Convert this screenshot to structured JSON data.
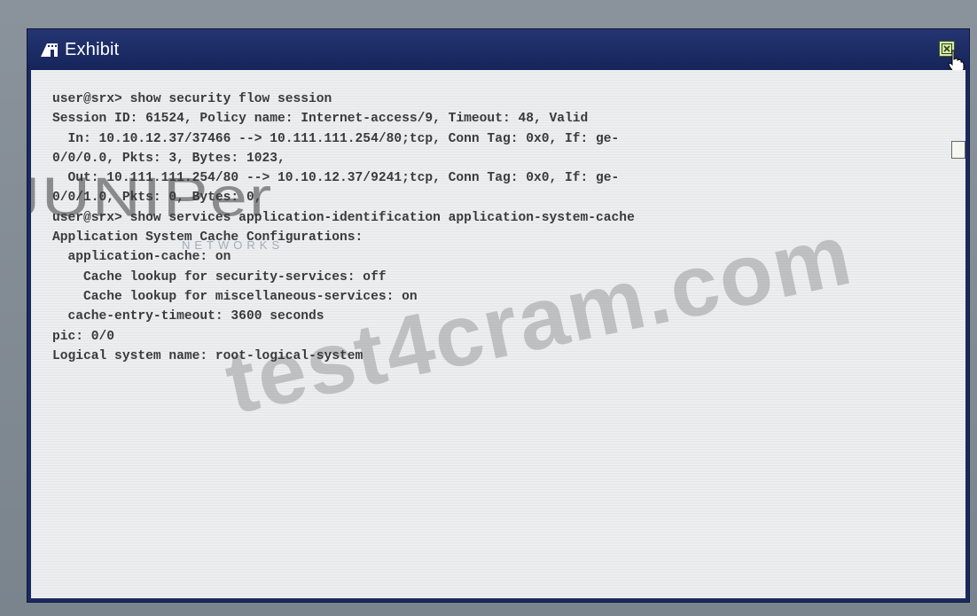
{
  "window": {
    "title": "Exhibit",
    "title_icon": "exhibit-icon",
    "close_icon": "close-icon"
  },
  "terminal": {
    "lines": [
      "user@srx> show security flow session",
      "Session ID: 61524, Policy name: Internet-access/9, Timeout: 48, Valid",
      "  In: 10.10.12.37/37466 --> 10.111.111.254/80;tcp, Conn Tag: 0x0, If: ge-",
      "0/0/0.0, Pkts: 3, Bytes: 1023,",
      "  Out: 10.111.111.254/80 --> 10.10.12.37/9241;tcp, Conn Tag: 0x0, If: ge-",
      "0/0/1.0, Pkts: 0, Bytes: 0,",
      "user@srx> show services application-identification application-system-cache",
      "Application System Cache Configurations:",
      "  application-cache: on",
      "    Cache lookup for security-services: off",
      "    Cache lookup for miscellaneous-services: on",
      "  cache-entry-timeout: 3600 seconds",
      "pic: 0/0",
      "Logical system name: root-logical-system"
    ]
  },
  "watermarks": {
    "brand": "JUNIPer",
    "brand_sub": "NETWORKS",
    "site": "test4cram.com"
  },
  "colors": {
    "titlebar": "#1b2a5e",
    "content_bg": "#eceef0",
    "text": "#3a3a3a"
  }
}
